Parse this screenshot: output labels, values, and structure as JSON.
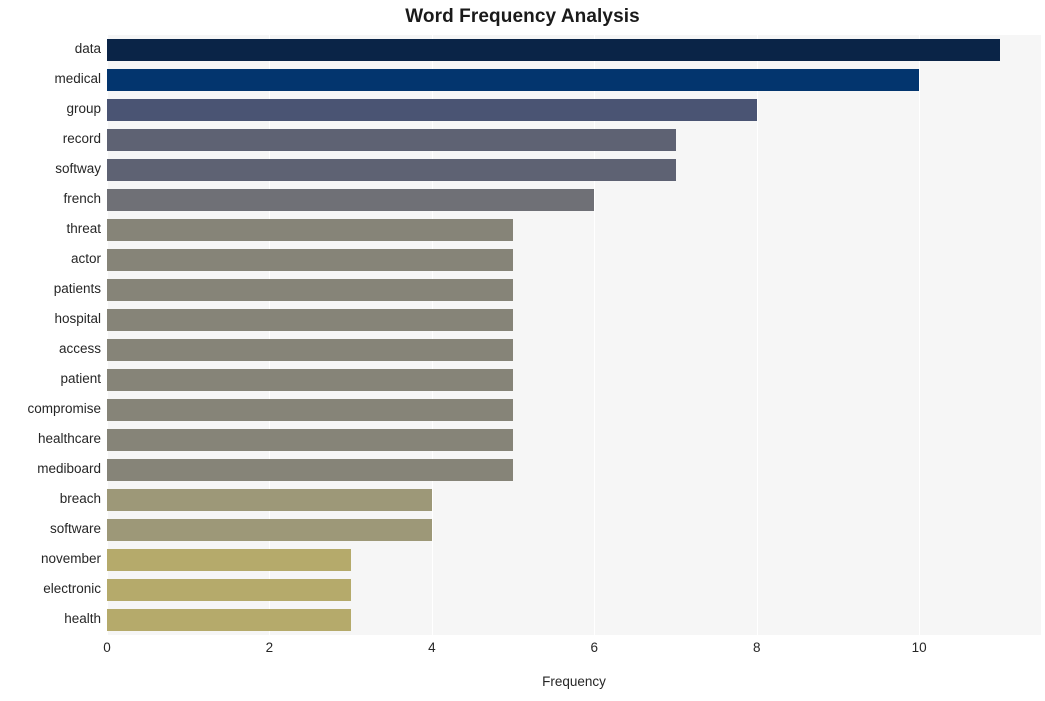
{
  "chart_data": {
    "type": "bar",
    "orientation": "horizontal",
    "title": "Word Frequency Analysis",
    "xlabel": "Frequency",
    "ylabel": "",
    "categories": [
      "data",
      "medical",
      "group",
      "record",
      "softway",
      "french",
      "threat",
      "actor",
      "patients",
      "hospital",
      "access",
      "patient",
      "compromise",
      "healthcare",
      "mediboard",
      "breach",
      "software",
      "november",
      "electronic",
      "health"
    ],
    "values": [
      11,
      10,
      8,
      7,
      7,
      6,
      5,
      5,
      5,
      5,
      5,
      5,
      5,
      5,
      5,
      4,
      4,
      3,
      3,
      3
    ],
    "bar_colors": [
      "#0a2447",
      "#03356e",
      "#4a5473",
      "#5e6273",
      "#5e6273",
      "#6f7076",
      "#868478",
      "#868478",
      "#868478",
      "#868478",
      "#868478",
      "#868478",
      "#868478",
      "#868478",
      "#868478",
      "#9d9878",
      "#9d9878",
      "#b5aa6b",
      "#b5aa6b",
      "#b5aa6b"
    ],
    "xticks": [
      0,
      2,
      4,
      6,
      8,
      10
    ],
    "xtick_labels": [
      "0",
      "2",
      "4",
      "6",
      "8",
      "10"
    ],
    "xlim": [
      0,
      11.5
    ],
    "grid": true,
    "grid_axis": "x",
    "grid_color": "#ffffff",
    "plot_background": "#f6f6f6",
    "figure_background": "#ffffff",
    "legend": null
  }
}
